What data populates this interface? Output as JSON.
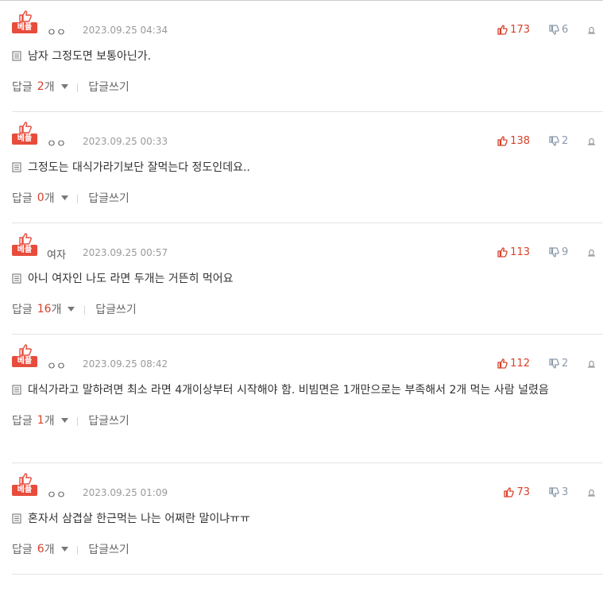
{
  "labels": {
    "best": "베플",
    "reply": "답글",
    "reply_unit": "개",
    "write_reply": "답글쓰기"
  },
  "colors": {
    "accent": "#e74c3c",
    "upvote": "#d9402b",
    "downvote": "#8a9aab"
  },
  "comments": [
    {
      "nick": "ㅇㅇ",
      "date": "2023.09.25 04:34",
      "up": "173",
      "down": "6",
      "text": "남자 그정도면 보통아닌가.",
      "replies": "2"
    },
    {
      "nick": "ㅇㅇ",
      "date": "2023.09.25 00:33",
      "up": "138",
      "down": "2",
      "text": "그정도는 대식가라기보단 잘먹는다 정도인데요..",
      "replies": "0"
    },
    {
      "nick": "여자",
      "date": "2023.09.25 00:57",
      "up": "113",
      "down": "9",
      "text": "아니 여자인 나도 라면 두개는 거뜬히 먹어요",
      "replies": "16"
    },
    {
      "nick": "ㅇㅇ",
      "date": "2023.09.25 08:42",
      "up": "112",
      "down": "2",
      "text": "대식가라고 말하려면 최소 라면 4개이상부터 시작해야 함. 비빔면은 1개만으로는 부족해서 2개 먹는 사람 널렸음",
      "replies": "1"
    },
    {
      "nick": "ㅇㅇ",
      "date": "2023.09.25 01:09",
      "up": "73",
      "down": "3",
      "text": "혼자서 삼겹살 한근먹는 나는 어쩌란 말이냐ㅠㅠ",
      "replies": "6"
    }
  ]
}
